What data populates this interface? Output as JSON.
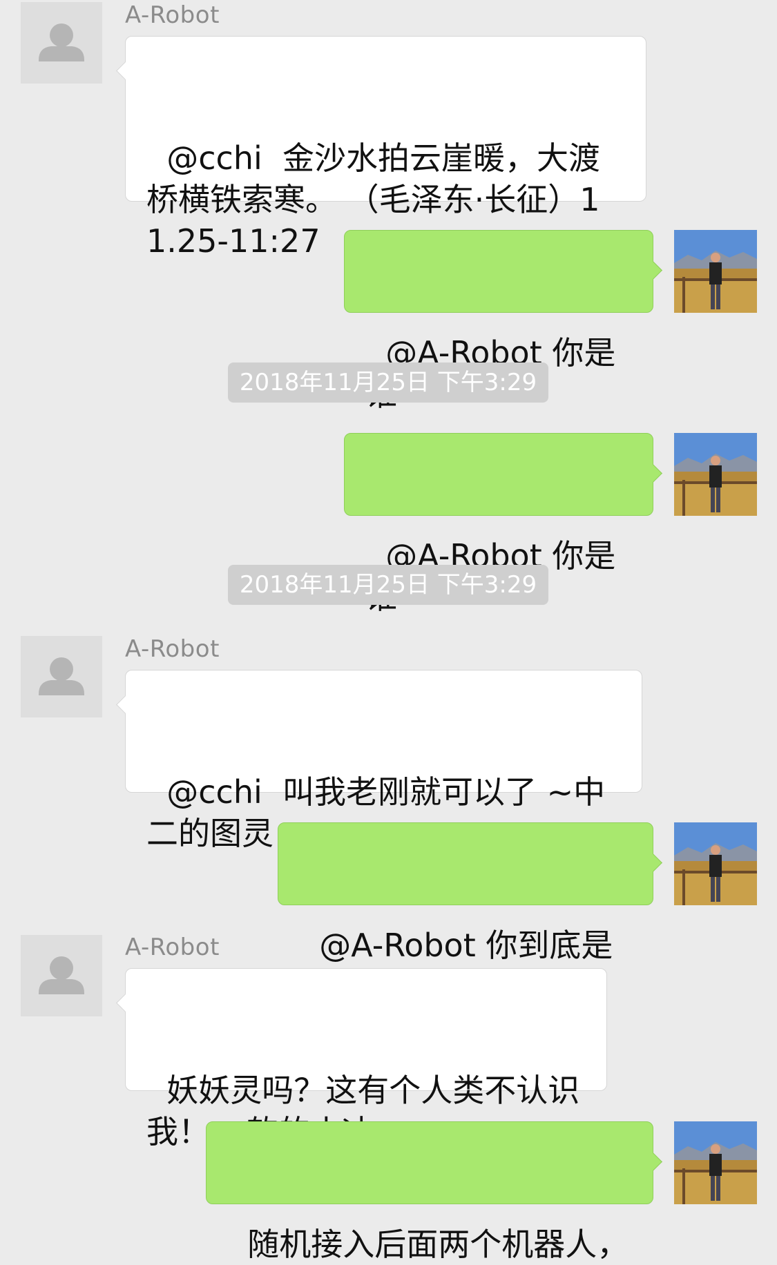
{
  "messages": [
    {
      "sender": "A-Robot",
      "text": "@cchi  金沙水拍云崖暖，大渡桥横铁索寒。 （毛泽东·长征）11.25-11:27"
    },
    {
      "text": "@A-Robot 你是谁"
    },
    {
      "timestamp": "2018年11月25日 下午3:29"
    },
    {
      "text": "@A-Robot 你是谁"
    },
    {
      "timestamp": "2018年11月25日 下午3:29"
    },
    {
      "sender": "A-Robot",
      "text": "@cchi  叫我老刚就可以了 ~中二的图灵"
    },
    {
      "text": "@A-Robot 你到底是谁"
    },
    {
      "sender": "A-Robot",
      "text": "妖妖灵吗？这有个人类不认识我！ ~软的小冰"
    },
    {
      "text": "随机接入后面两个机器人，"
    }
  ],
  "icons": {
    "default_avatar": "person-silhouette-icon",
    "user_avatar": "landscape-photo-avatar"
  },
  "colors": {
    "background": "#ebebeb",
    "bubble_self": "#a8e86e",
    "bubble_other": "#ffffff",
    "timestamp_bg": "#cfcfcf",
    "sender_name": "#8b8b8b"
  }
}
